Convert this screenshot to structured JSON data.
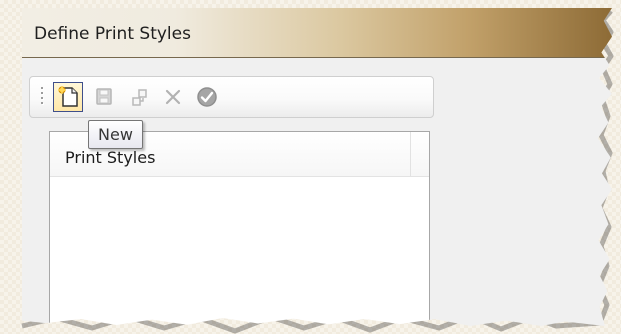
{
  "window": {
    "title": "Define Print Styles"
  },
  "toolbar": {
    "buttons": [
      {
        "name": "new",
        "icon": "new-document-icon",
        "state": "active",
        "color": "#ffcc33"
      },
      {
        "name": "save",
        "icon": "save-icon",
        "state": "disabled",
        "color": "#b6b6b6"
      },
      {
        "name": "copy",
        "icon": "copy-icon",
        "state": "disabled",
        "color": "#b6b6b6"
      },
      {
        "name": "delete",
        "icon": "delete-icon",
        "state": "disabled",
        "color": "#b6b6b6"
      },
      {
        "name": "apply",
        "icon": "checkmark-icon",
        "state": "disabled",
        "color": "#9c9c9c"
      }
    ]
  },
  "list": {
    "column_label": "Print Styles",
    "items": []
  },
  "tooltip": {
    "text": "New"
  },
  "colors": {
    "title_bar_gradient_end": "#8d6b36",
    "selection_border": "#3f4f8b"
  }
}
